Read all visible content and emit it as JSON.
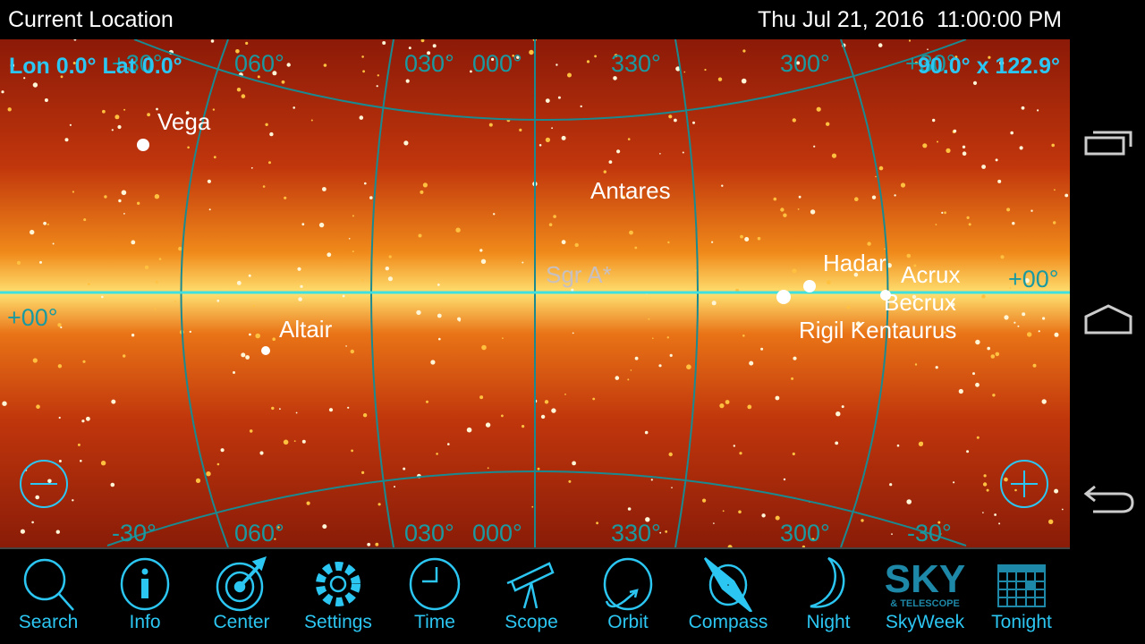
{
  "status": {
    "location": "Current Location",
    "datetime": "Thu Jul 21, 2016  11:00:00 PM"
  },
  "hud": {
    "coords": "Lon 0.0° Lat 0.0°",
    "fov": "90.0° x 122.9°"
  },
  "grid": {
    "top_labels": [
      "+30°",
      "060°",
      "030°",
      "000°",
      "330°",
      "300°",
      "+30°"
    ],
    "bottom_labels": [
      "-30°",
      "060°",
      "030°",
      "000°",
      "330°",
      "300°",
      "-30°"
    ],
    "equator_left": "+00°",
    "equator_right": "+00°"
  },
  "stars": {
    "vega": "Vega",
    "antares": "Antares",
    "hadar": "Hadar",
    "acrux": "Acrux",
    "becrux": "Becrux",
    "rigil": "Rigil Kentaurus",
    "altair": "Altair",
    "sgra": "Sgr A*"
  },
  "toolbar": [
    "Search",
    "Info",
    "Center",
    "Settings",
    "Time",
    "Scope",
    "Orbit",
    "Compass",
    "Night",
    "SkyWeek",
    "Tonight"
  ],
  "logo": {
    "line1": "SKY",
    "line2": "& TELESCOPE"
  },
  "colors": {
    "accent": "#2cc6f2",
    "grid": "#1a9aa0",
    "equator": "#3ee0e0"
  }
}
